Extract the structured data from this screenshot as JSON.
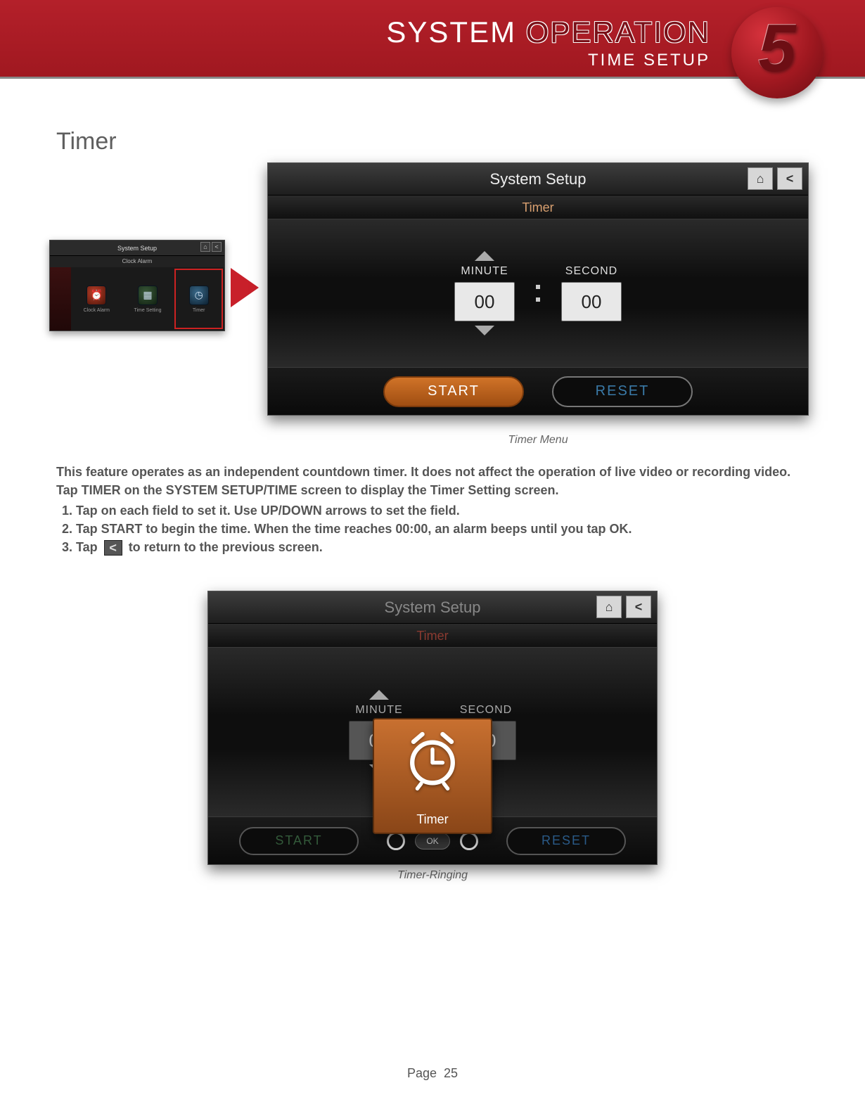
{
  "header": {
    "title_left": "SYSTEM ",
    "title_right": "OPERATION",
    "subtitle": "TIME SETUP",
    "chapter": "5"
  },
  "page_heading": "Timer",
  "thumb": {
    "title": "System Setup",
    "subtitle": "Clock Alarm",
    "items": [
      "Clock Alarm",
      "Time Setting",
      "Timer"
    ]
  },
  "timer_panel": {
    "title": "System Setup",
    "subtitle": "Timer",
    "minute_label": "MINUTE",
    "second_label": "SECOND",
    "minute_value": "00",
    "second_value": "00",
    "start": "START",
    "reset": "RESET"
  },
  "caption1": "Timer Menu",
  "body": {
    "p1": "This feature operates as an independent countdown timer. It does not affect the operation of live video or recording video.",
    "p2": "Tap TIMER on the SYSTEM SETUP/TIME  screen to display the Timer Setting screen.",
    "li1": "Tap on each field to set it. Use UP/DOWN arrows to set the field.",
    "li2": "Tap START to begin the time. When the time reaches 00:00, an alarm beeps until you tap OK.",
    "li3a": "Tap ",
    "li3b": " to return to the previous screen."
  },
  "ring_panel": {
    "title": "System Setup",
    "subtitle": "Timer",
    "minute_label": "MINUTE",
    "second_label": "SECOND",
    "minute_value": "00",
    "second_value": "00",
    "start": "START",
    "reset": "RESET",
    "modal_label": "Timer",
    "ok": "OK"
  },
  "caption2": "Timer-Ringing",
  "footer": {
    "label": "Page",
    "number": "25"
  }
}
